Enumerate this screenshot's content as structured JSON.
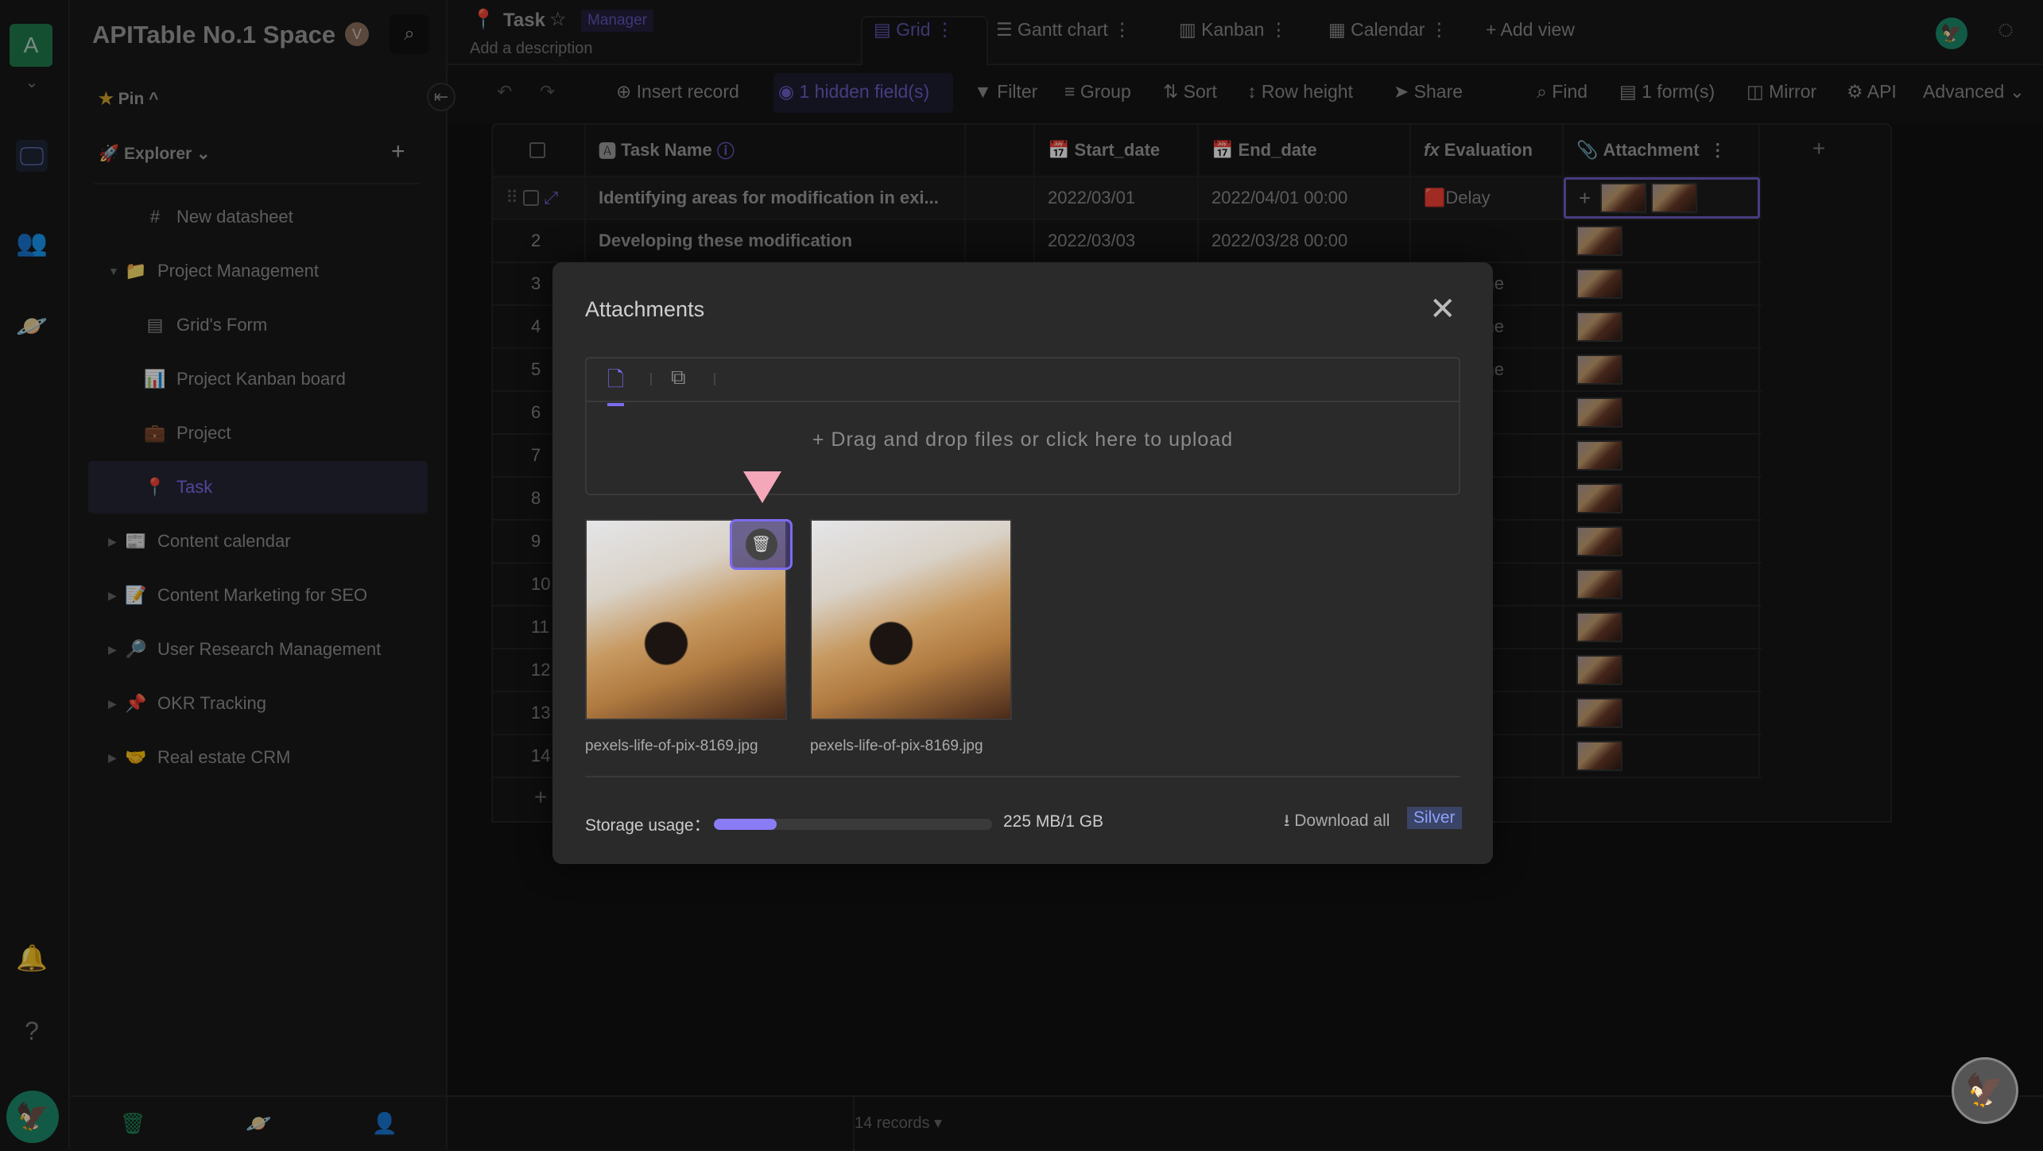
{
  "rail": {
    "space_initial": "A",
    "icons": [
      "workbench-icon",
      "members-icon",
      "explore-icon"
    ],
    "bottom_icons": [
      "bell-icon",
      "help-icon"
    ]
  },
  "sidebar": {
    "space_name": "APITable No.1 Space",
    "pin_label": "Pin",
    "explorer_label": "Explorer",
    "items": [
      {
        "label": "New datasheet",
        "icon": "#",
        "level": 1,
        "arrow": ""
      },
      {
        "label": "Project Management",
        "icon": "📁",
        "level": 0,
        "arrow": "▼"
      },
      {
        "label": "Grid's Form",
        "icon": "▤",
        "level": 1,
        "arrow": ""
      },
      {
        "label": "Project Kanban board",
        "icon": "📊",
        "level": 1,
        "arrow": ""
      },
      {
        "label": "Project",
        "icon": "💼",
        "level": 1,
        "arrow": ""
      },
      {
        "label": "Task",
        "icon": "📍",
        "level": 1,
        "arrow": "",
        "selected": true
      },
      {
        "label": "Content calendar",
        "icon": "📰",
        "level": 0,
        "arrow": "▶"
      },
      {
        "label": "Content Marketing for SEO",
        "icon": "📝",
        "level": 0,
        "arrow": "▶"
      },
      {
        "label": "User Research Management",
        "icon": "🔎",
        "level": 0,
        "arrow": "▶"
      },
      {
        "label": "OKR Tracking",
        "icon": "📌",
        "level": 0,
        "arrow": "▶"
      },
      {
        "label": "Real estate CRM",
        "icon": "🤝",
        "level": 0,
        "arrow": "▶"
      }
    ]
  },
  "header": {
    "title": "Task",
    "role_badge": "Manager",
    "description": "Add a description",
    "views": [
      "Grid",
      "Gantt chart",
      "Kanban",
      "Calendar"
    ],
    "add_view": "+ Add view"
  },
  "toolbar": {
    "insert_record": "Insert record",
    "hidden_fields": "1 hidden field(s)",
    "filter": "Filter",
    "group": "Group",
    "sort": "Sort",
    "row_height": "Row height",
    "share": "Share",
    "find": "Find",
    "forms": "1 form(s)",
    "mirror": "Mirror",
    "api": "API",
    "advanced": "Advanced"
  },
  "grid": {
    "columns": [
      "Task Name",
      "Start_date",
      "End_date",
      "Evaluation",
      "Attachment"
    ],
    "rows": [
      {
        "n": "1",
        "task": "Identifying areas for modification in exi...",
        "start": "2022/03/01",
        "end": "2022/04/01 00:00",
        "eval": "Delay",
        "att": 2
      },
      {
        "n": "2",
        "task": "Developing these modification",
        "start": "2022/03/03",
        "end": "2022/03/28 00:00",
        "eval": "",
        "att": 1
      },
      {
        "n": "3",
        "task": "",
        "start": "",
        "end": "",
        "eval": "On time",
        "att": 1
      },
      {
        "n": "4",
        "task": "",
        "start": "",
        "end": "",
        "eval": "On time",
        "att": 1
      },
      {
        "n": "5",
        "task": "",
        "start": "",
        "end": "",
        "eval": "On time",
        "att": 1
      },
      {
        "n": "6",
        "att": 1
      },
      {
        "n": "7",
        "att": 1
      },
      {
        "n": "8",
        "att": 1
      },
      {
        "n": "9",
        "att": 1
      },
      {
        "n": "10",
        "att": 1
      },
      {
        "n": "11",
        "att": 1
      },
      {
        "n": "12",
        "att": 1
      },
      {
        "n": "13",
        "att": 1
      },
      {
        "n": "14",
        "att": 1
      }
    ],
    "record_count": "14 records ▾"
  },
  "modal": {
    "title": "Attachments",
    "upload_text": "+ Drag and drop files or click here to upload",
    "files": [
      {
        "name": "pexels-life-of-pix-8169.jpg"
      },
      {
        "name": "pexels-life-of-pix-8169.jpg"
      }
    ],
    "storage_label": "Storage usage：",
    "storage_value": "225 MB/1 GB",
    "storage_fraction": 0.225,
    "download_all": "Download all",
    "plan_badge": "Silver"
  },
  "colors": {
    "accent": "#7b6cf0",
    "storage_fill": "#8a7cf5",
    "space_avatar": "#1f7a4e",
    "pointer": "#f4a7b9"
  }
}
